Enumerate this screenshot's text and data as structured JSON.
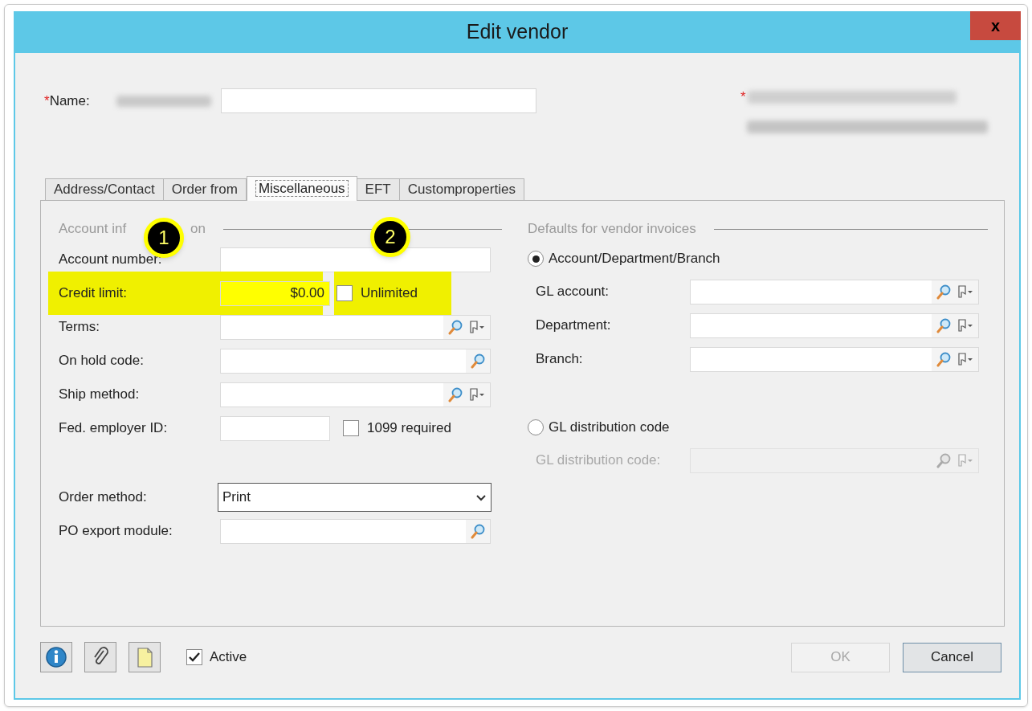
{
  "window": {
    "title": "Edit vendor",
    "close": "x"
  },
  "header": {
    "required_mark": "*",
    "name_label": "Name:",
    "name_redacted": true,
    "number_redacted": true,
    "created_redacted": true
  },
  "tabs": [
    {
      "label": "Address/Contact",
      "selected": false
    },
    {
      "label": "Order from",
      "selected": false
    },
    {
      "label": "Miscellaneous",
      "selected": true
    },
    {
      "label": "EFT",
      "selected": false
    },
    {
      "label": "Customproperties",
      "selected": false
    }
  ],
  "account_information": {
    "title_parts": [
      "Account inf",
      "on"
    ],
    "rows": [
      {
        "label": "Account number:",
        "kind": "text"
      },
      {
        "label": "Credit limit:",
        "kind": "text",
        "value": "$0.00",
        "highlighted": true,
        "checkbox": {
          "label": "Unlimited",
          "checked": false,
          "highlighted": true
        }
      },
      {
        "label": "Terms:",
        "kind": "lookup",
        "picker": true
      },
      {
        "label": "On hold code:",
        "kind": "lookup",
        "picker": false
      },
      {
        "label": "Ship method:",
        "kind": "lookup",
        "picker": true
      },
      {
        "label": "Fed. employer ID:",
        "kind": "short",
        "checkbox": {
          "label": "1099 required",
          "checked": false,
          "highlighted": false
        }
      },
      {
        "label": "Order method:",
        "kind": "select",
        "value": "Print"
      },
      {
        "label": "PO export module:",
        "kind": "lookup",
        "picker": false
      }
    ]
  },
  "invoice_defaults": {
    "title": "Defaults for vendor invoices",
    "options": [
      {
        "label": "Account/Department/Branch",
        "selected": true,
        "fields": [
          {
            "label": "GL account:",
            "disabled": false
          },
          {
            "label": "Department:",
            "disabled": false
          },
          {
            "label": "Branch:",
            "disabled": false
          }
        ]
      },
      {
        "label": "GL distribution code",
        "selected": false,
        "fields": [
          {
            "label": "GL distribution code:",
            "disabled": true
          }
        ]
      }
    ]
  },
  "callouts": [
    {
      "number": "1"
    },
    {
      "number": "2"
    }
  ],
  "footer": {
    "active": {
      "label": "Active",
      "checked": true
    },
    "buttons": [
      {
        "label": "OK",
        "disabled": true
      },
      {
        "label": "Cancel",
        "disabled": false
      }
    ]
  }
}
